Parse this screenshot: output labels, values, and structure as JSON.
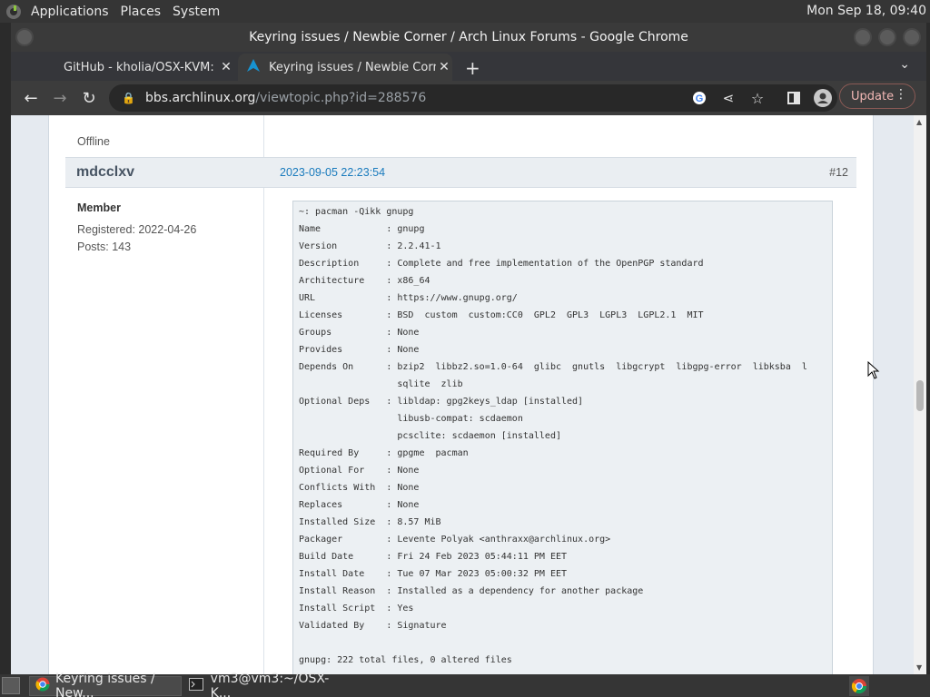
{
  "panel": {
    "menus": [
      "Applications",
      "Places",
      "System"
    ],
    "clock": "Mon Sep 18, 09:40"
  },
  "window": {
    "title": "Keyring issues / Newbie Corner / Arch Linux Forums - Google Chrome"
  },
  "tabs": [
    {
      "label": "GitHub - kholia/OSX-KVM: Run",
      "icon": "github-icon"
    },
    {
      "label": "Keyring issues / Newbie Corner",
      "icon": "arch-logo-icon"
    }
  ],
  "toolbar": {
    "url_host": "bbs.archlinux.org",
    "url_path": "/viewtopic.php?id=288576",
    "update_label": "Update"
  },
  "post_prev": {
    "status": "Offline"
  },
  "post": {
    "author": "mdcclxv",
    "date": "2023-09-05 22:23:54",
    "number": "#12",
    "role": "Member",
    "registered": "Registered: 2022-04-26",
    "posts": "Posts: 143",
    "code_lines": [
      "~: pacman -Qikk gnupg",
      "Name            : gnupg",
      "Version         : 2.2.41-1",
      "Description     : Complete and free implementation of the OpenPGP standard",
      "Architecture    : x86_64",
      "URL             : https://www.gnupg.org/",
      "Licenses        : BSD  custom  custom:CC0  GPL2  GPL3  LGPL3  LGPL2.1  MIT",
      "Groups          : None",
      "Provides        : None",
      "Depends On      : bzip2  libbz2.so=1.0-64  glibc  gnutls  libgcrypt  libgpg-error  libksba  l",
      "                  sqlite  zlib",
      "Optional Deps   : libldap: gpg2keys_ldap [installed]",
      "                  libusb-compat: scdaemon",
      "                  pcsclite: scdaemon [installed]",
      "Required By     : gpgme  pacman",
      "Optional For    : None",
      "Conflicts With  : None",
      "Replaces        : None",
      "Installed Size  : 8.57 MiB",
      "Packager        : Levente Polyak <anthraxx@archlinux.org>",
      "Build Date      : Fri 24 Feb 2023 05:44:11 PM EET",
      "Install Date    : Tue 07 Mar 2023 05:00:32 PM EET",
      "Install Reason  : Installed as a dependency for another package",
      "Install Script  : Yes",
      "Validated By    : Signature",
      "",
      "gnupg: 222 total files, 0 altered files"
    ]
  },
  "taskbar": {
    "tasks": [
      {
        "label": "Keyring issues / New...",
        "icon": "chrome-icon"
      },
      {
        "label": "vm3@vm3:~/OSX-K...",
        "icon": "terminal-icon"
      }
    ]
  },
  "colors": {
    "link": "#1a7bbd",
    "author": "#475463",
    "update_text": "#f2b8b5"
  }
}
